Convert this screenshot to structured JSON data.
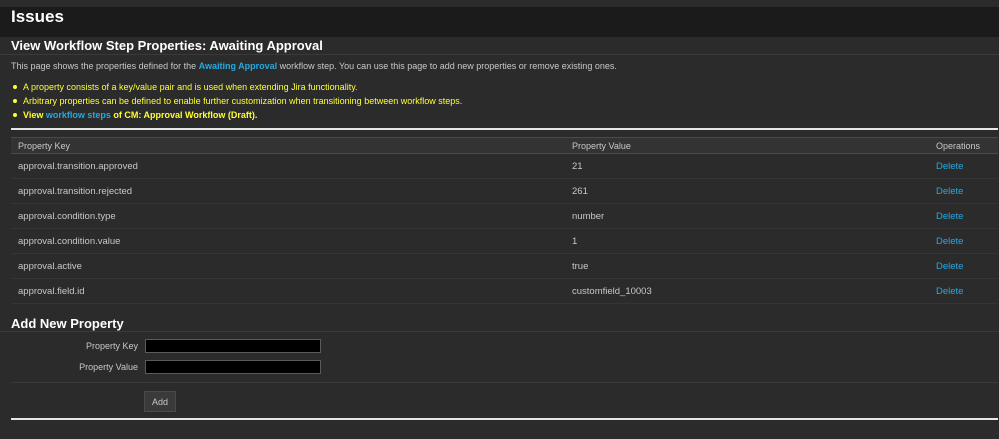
{
  "header": {
    "title": "Issues"
  },
  "page": {
    "title": "View Workflow Step Properties: Awaiting Approval",
    "description": {
      "before": "This page shows the properties defined for the ",
      "step_name": "Awaiting Approval",
      "after": " workflow step. You can use this page to add new properties or remove existing ones."
    },
    "bullets": {
      "item1": "A property consists of a key/value pair and is used when extending Jira functionality.",
      "item2": "Arbitrary properties can be defined to enable further customization when transitioning between workflow steps.",
      "item3_prefix": "View ",
      "item3_link": "workflow steps",
      "item3_suffix": " of CM: Approval Workflow (Draft)."
    }
  },
  "table": {
    "headers": {
      "key": "Property Key",
      "value": "Property Value",
      "operations": "Operations"
    },
    "rows": [
      {
        "key": "approval.transition.approved",
        "value": "21",
        "op": "Delete"
      },
      {
        "key": "approval.transition.rejected",
        "value": "261",
        "op": "Delete"
      },
      {
        "key": "approval.condition.type",
        "value": "number",
        "op": "Delete"
      },
      {
        "key": "approval.condition.value",
        "value": "1",
        "op": "Delete"
      },
      {
        "key": "approval.active",
        "value": "true",
        "op": "Delete"
      },
      {
        "key": "approval.field.id",
        "value": "customfield_10003",
        "op": "Delete"
      }
    ]
  },
  "add_form": {
    "title": "Add New Property",
    "key_label": "Property Key",
    "key_value": "",
    "value_label": "Property Value",
    "value_value": "",
    "submit_label": "Add"
  },
  "colors": {
    "link": "#26a9e0",
    "note": "#ffff33",
    "background": "#2b2b2b",
    "header": "#1b1b1b"
  }
}
